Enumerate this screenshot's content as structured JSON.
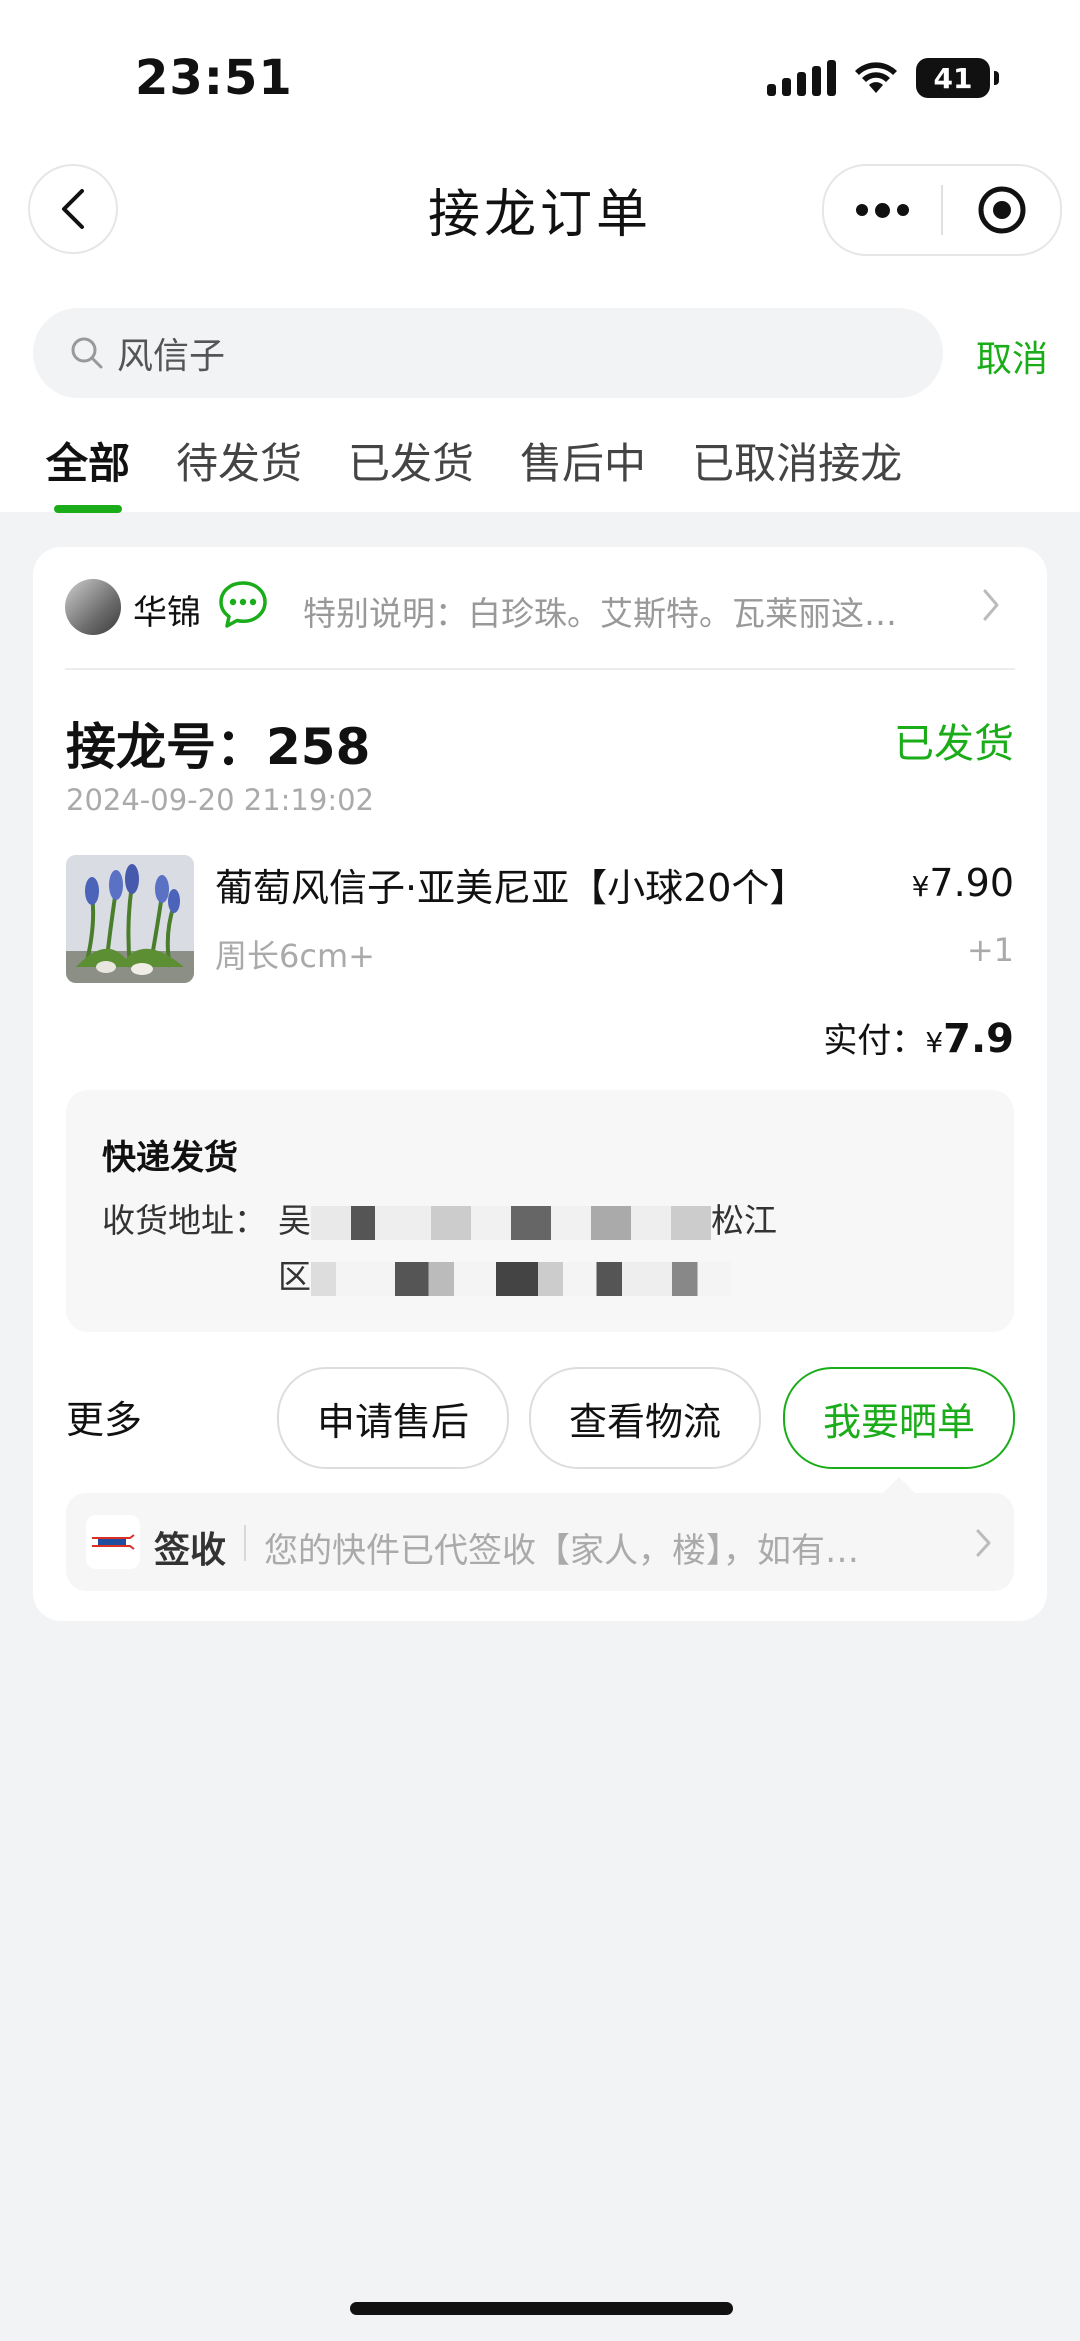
{
  "status_bar": {
    "time": "23:51",
    "battery": "41"
  },
  "nav": {
    "title": "接龙订单"
  },
  "search": {
    "query": "风信子",
    "cancel_label": "取消"
  },
  "tabs": [
    {
      "label": "全部",
      "active": true
    },
    {
      "label": "待发货"
    },
    {
      "label": "已发货"
    },
    {
      "label": "售后中"
    },
    {
      "label": "已取消接龙"
    }
  ],
  "order": {
    "seller_name": "华锦",
    "note": "特别说明：白珍珠。艾斯特。瓦莱丽这…",
    "order_number": "接龙号：258",
    "status": "已发货",
    "date": "2024-09-20 21:19:02",
    "product": {
      "name": "葡萄风信子·亚美尼亚【小球20个】",
      "spec": "周长6cm+",
      "price_symbol": "¥",
      "price": "7.90",
      "qty": "+1"
    },
    "paid_label": "实付：",
    "paid_symbol": "¥",
    "paid_amount": "7.9",
    "shipping": {
      "title": "快递发货",
      "address_label": "收货地址：",
      "address_line1_start": "吴",
      "address_line1_end": "松江",
      "address_line2_start": "区"
    },
    "actions": {
      "more_label": "更多",
      "after_sales": "申请售后",
      "view_logistics": "查看物流",
      "show_order": "我要晒单"
    },
    "tracking": {
      "carrier_logo_text": "EMS",
      "label": "签收",
      "text": "您的快件已代签收【家人，楼】，如有…"
    }
  },
  "colors": {
    "accent": "#1aad19",
    "background": "#f2f3f5"
  }
}
